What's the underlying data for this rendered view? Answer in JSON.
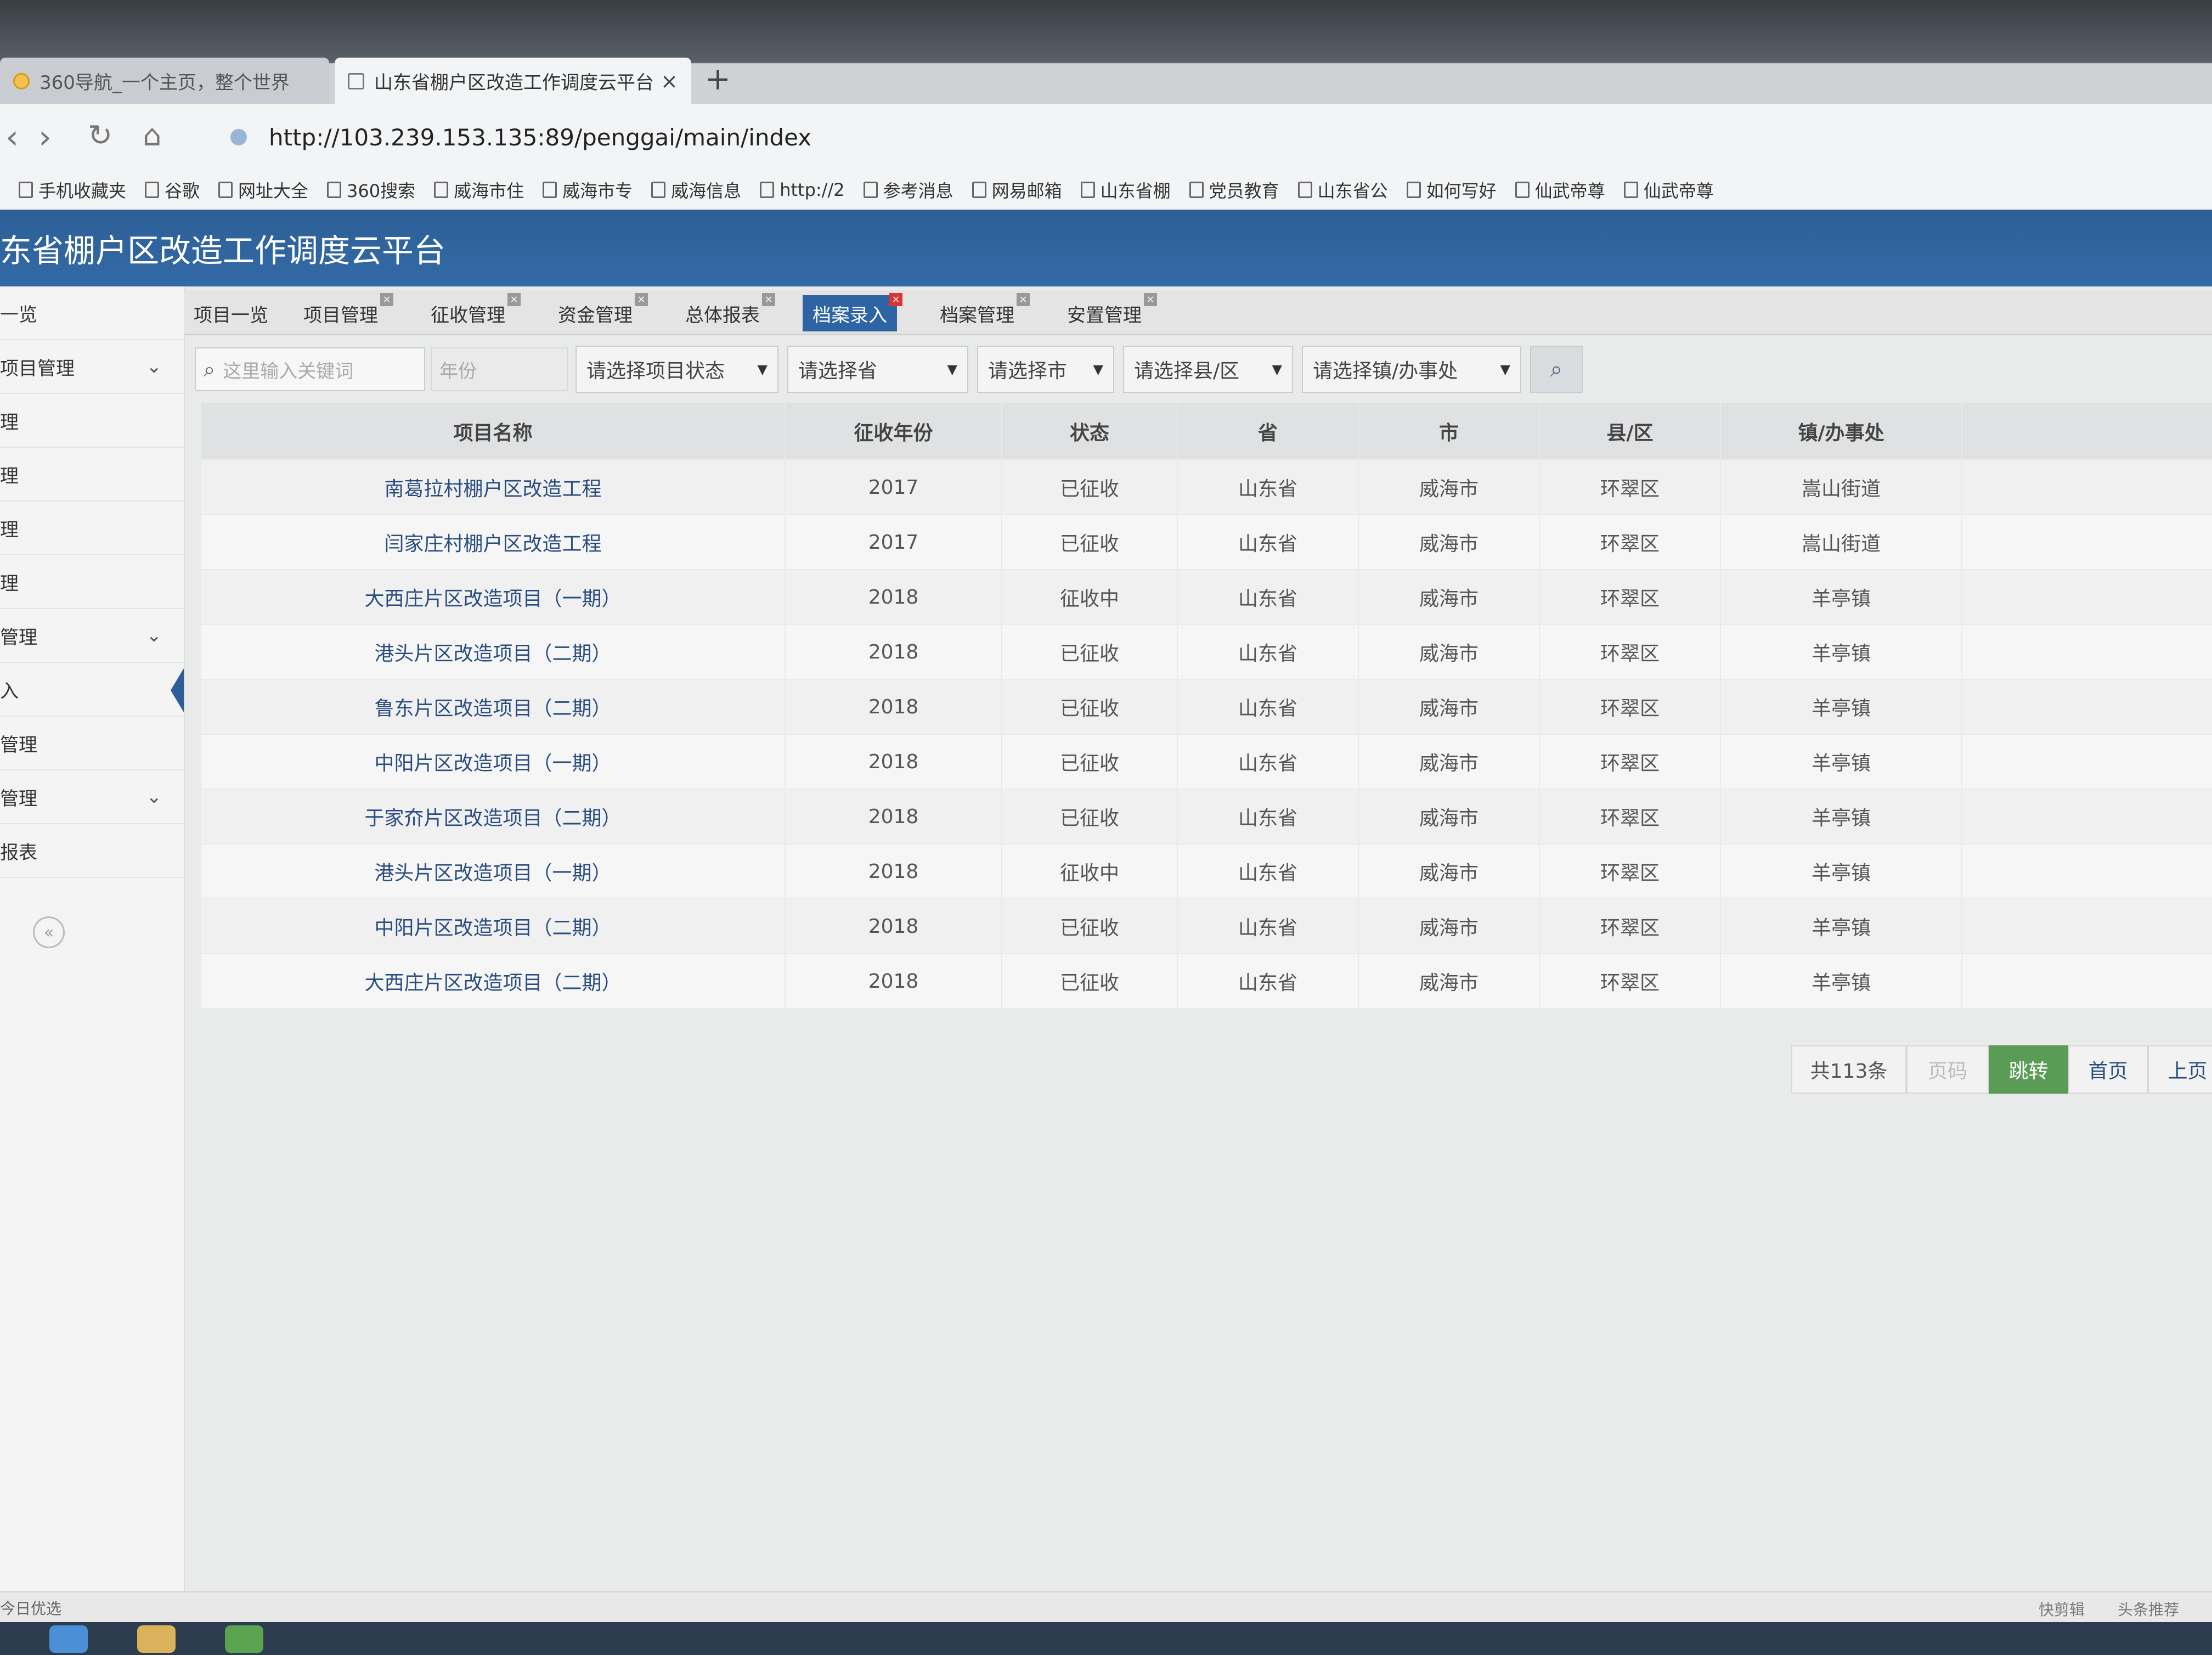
{
  "browser": {
    "tabs": [
      {
        "label": "360导航_一个主页，整个世界"
      },
      {
        "label": "山东省棚户区改造工作调度云平台"
      }
    ],
    "new_tab": "+",
    "close": "×",
    "url": "http://103.239.153.135:89/penggai/main/index",
    "bookmarks": [
      "手机收藏夹",
      "谷歌",
      "网址大全",
      "360搜索",
      "威海市住",
      "威海市专",
      "威海信息",
      "http://2",
      "参考消息",
      "网易邮箱",
      "山东省棚",
      "党员教育",
      "山东省公",
      "如何写好",
      "仙武帝尊",
      "仙武帝尊"
    ]
  },
  "app": {
    "title": "东省棚户区改造工作调度云平台",
    "sidebar": [
      {
        "label": "一览",
        "chevron": ""
      },
      {
        "label": "项目管理",
        "chevron": "⌄"
      },
      {
        "label": "理",
        "chevron": ""
      },
      {
        "label": "理",
        "chevron": ""
      },
      {
        "label": "理",
        "chevron": ""
      },
      {
        "label": "理",
        "chevron": ""
      },
      {
        "label": "管理",
        "chevron": "⌄"
      },
      {
        "label": "入",
        "chevron": ""
      },
      {
        "label": "管理",
        "chevron": ""
      },
      {
        "label": "管理",
        "chevron": "⌄"
      },
      {
        "label": "报表",
        "chevron": ""
      }
    ],
    "collapse": "«",
    "tabs": [
      "项目一览",
      "项目管理",
      "征收管理",
      "资金管理",
      "总体报表",
      "档案录入",
      "档案管理",
      "安置管理"
    ],
    "active_tab": "档案录入",
    "filters": {
      "keyword_placeholder": "这里输入关键词",
      "year_placeholder": "年份",
      "status": "请选择项目状态",
      "province": "请选择省",
      "city": "请选择市",
      "county": "请选择县/区",
      "town": "请选择镇/办事处"
    },
    "table": {
      "columns": [
        "项目名称",
        "征收年份",
        "状态",
        "省",
        "市",
        "县/区",
        "镇/办事处"
      ],
      "rows": [
        [
          "南葛拉村棚户区改造工程",
          "2017",
          "已征收",
          "山东省",
          "威海市",
          "环翠区",
          "嵩山街道"
        ],
        [
          "闫家庄村棚户区改造工程",
          "2017",
          "已征收",
          "山东省",
          "威海市",
          "环翠区",
          "嵩山街道"
        ],
        [
          "大西庄片区改造项目（一期）",
          "2018",
          "征收中",
          "山东省",
          "威海市",
          "环翠区",
          "羊亭镇"
        ],
        [
          "港头片区改造项目（二期）",
          "2018",
          "已征收",
          "山东省",
          "威海市",
          "环翠区",
          "羊亭镇"
        ],
        [
          "鲁东片区改造项目（二期）",
          "2018",
          "已征收",
          "山东省",
          "威海市",
          "环翠区",
          "羊亭镇"
        ],
        [
          "中阳片区改造项目（一期）",
          "2018",
          "已征收",
          "山东省",
          "威海市",
          "环翠区",
          "羊亭镇"
        ],
        [
          "于家夼片区改造项目（二期）",
          "2018",
          "已征收",
          "山东省",
          "威海市",
          "环翠区",
          "羊亭镇"
        ],
        [
          "港头片区改造项目（一期）",
          "2018",
          "征收中",
          "山东省",
          "威海市",
          "环翠区",
          "羊亭镇"
        ],
        [
          "中阳片区改造项目（二期）",
          "2018",
          "已征收",
          "山东省",
          "威海市",
          "环翠区",
          "羊亭镇"
        ],
        [
          "大西庄片区改造项目（二期）",
          "2018",
          "已征收",
          "山东省",
          "威海市",
          "环翠区",
          "羊亭镇"
        ]
      ]
    },
    "pager": {
      "total": "共113条",
      "page_placeholder": "页码",
      "go": "跳转",
      "first": "首页",
      "prev": "上页"
    }
  },
  "status": {
    "left": "今日优选",
    "right": [
      "快剪辑",
      "头条推荐"
    ]
  },
  "colors": {
    "header": "#2d5f96",
    "active_tab": "#2e64a3",
    "go_button": "#5a9b56",
    "link": "#2a4d80"
  }
}
